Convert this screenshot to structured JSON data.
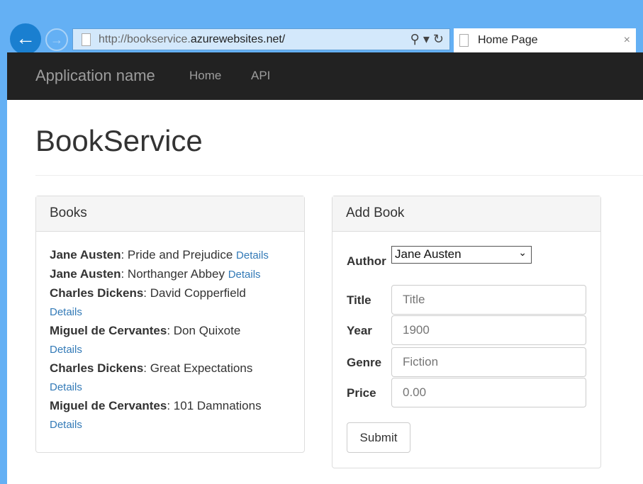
{
  "browser": {
    "url_prefix": "http://bookservice.",
    "url_domain": "azurewebsites.net/",
    "tab_title": "Home Page",
    "close": "×",
    "back": "←",
    "forward": "→",
    "search": "⚲ ▾",
    "refresh": "↻"
  },
  "nav": {
    "brand": "Application name",
    "links": [
      "Home",
      "API"
    ]
  },
  "page": {
    "title": "BookService"
  },
  "books_panel": {
    "title": "Books",
    "details_label": "Details",
    "items": [
      {
        "author": "Jane Austen",
        "title": "Pride and Prejudice"
      },
      {
        "author": "Jane Austen",
        "title": "Northanger Abbey"
      },
      {
        "author": "Charles Dickens",
        "title": "David Copperfield"
      },
      {
        "author": "Miguel de Cervantes",
        "title": "Don Quixote"
      },
      {
        "author": "Charles Dickens",
        "title": "Great Expectations"
      },
      {
        "author": "Miguel de Cervantes",
        "title": "101 Damnations"
      }
    ]
  },
  "add_book": {
    "title": "Add Book",
    "author_label": "Author",
    "author_value": "Jane Austen",
    "title_label": "Title",
    "title_placeholder": "Title",
    "year_label": "Year",
    "year_placeholder": "1900",
    "genre_label": "Genre",
    "genre_placeholder": "Fiction",
    "price_label": "Price",
    "price_placeholder": "0.00",
    "submit": "Submit"
  }
}
